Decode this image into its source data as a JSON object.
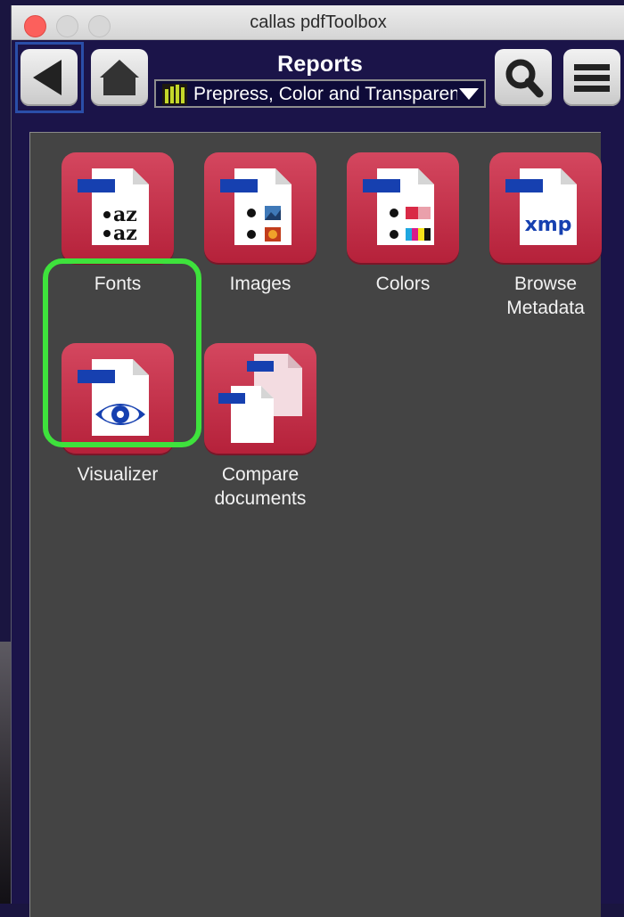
{
  "window": {
    "title": "callas pdfToolbox"
  },
  "toolbar": {
    "panel_title": "Reports",
    "profile_select": {
      "value": "Prepress, Color and Transparency",
      "icon": "bar-chart-icon"
    },
    "buttons": [
      {
        "name": "back",
        "icon": "triangle-left-icon"
      },
      {
        "name": "home",
        "icon": "house-icon"
      },
      {
        "name": "search",
        "icon": "magnifier-icon"
      },
      {
        "name": "menu",
        "icon": "hamburger-icon"
      }
    ]
  },
  "tiles": [
    {
      "id": "fonts",
      "label": "Fonts",
      "icon": "fonts-report-icon",
      "selected": true
    },
    {
      "id": "images",
      "label": "Images",
      "icon": "images-report-icon"
    },
    {
      "id": "colors",
      "label": "Colors",
      "icon": "colors-report-icon"
    },
    {
      "id": "metadata",
      "label": "Browse\nMetadata",
      "icon": "xmp-metadata-icon",
      "icon_text": "xmp"
    },
    {
      "id": "visualizer",
      "label": "Visualizer",
      "icon": "eye-icon"
    },
    {
      "id": "compare",
      "label": "Compare\ndocuments",
      "icon": "compare-documents-icon"
    }
  ],
  "colors": {
    "tile_red": "#c8304a",
    "highlight_green": "#3ee23c",
    "window_bg": "#1b1449",
    "content_bg": "#444444",
    "doc_blue": "#1640b0"
  }
}
